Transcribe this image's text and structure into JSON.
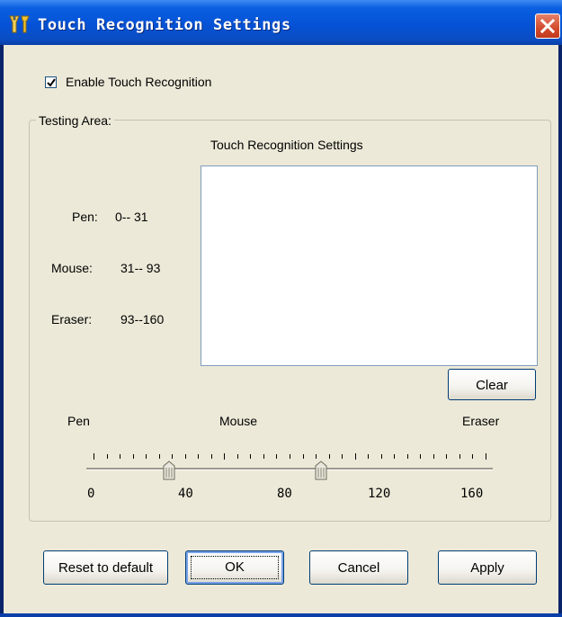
{
  "window": {
    "title": "Touch Recognition Settings",
    "title_icon": "tools-icon",
    "accent_color": "#0552d6",
    "face_color": "#ece9d8"
  },
  "enable": {
    "label": "Enable Touch Recognition",
    "checked": true
  },
  "group": {
    "legend": "Testing Area:",
    "header": "Touch Recognition Settings"
  },
  "ranges": [
    {
      "name": "Pen:",
      "range": "0-- 31"
    },
    {
      "name": "Mouse:",
      "range": "31-- 93"
    },
    {
      "name": "Eraser:",
      "range": "93--160"
    }
  ],
  "clear_label": "Clear",
  "slider": {
    "zone_labels": [
      "Pen",
      "Mouse",
      "Eraser"
    ],
    "scale_labels": [
      "0",
      "40",
      "80",
      "120",
      "160"
    ],
    "min": 0,
    "max": 160,
    "thumb_values": [
      31,
      93
    ]
  },
  "buttons": {
    "reset": "Reset to default",
    "ok": "OK",
    "cancel": "Cancel",
    "apply": "Apply"
  }
}
